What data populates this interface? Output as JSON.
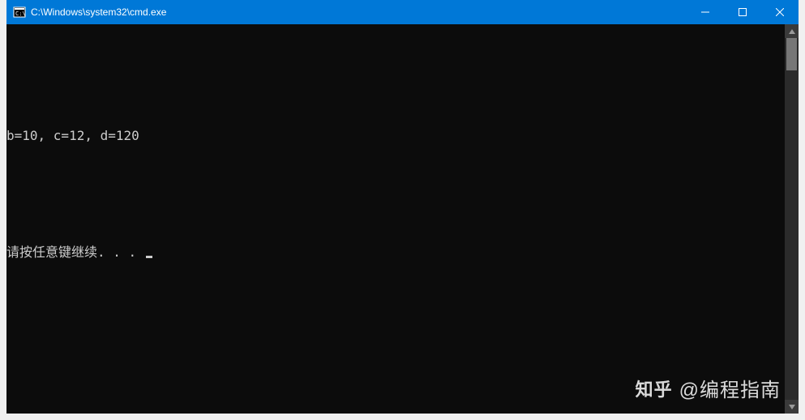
{
  "titlebar": {
    "title": "C:\\Windows\\system32\\cmd.exe"
  },
  "terminal": {
    "lines": [
      "",
      "b=10, c=12, d=120",
      "",
      "请按任意键继续. . . "
    ]
  },
  "watermark": {
    "logo": "知乎",
    "text": "@编程指南"
  }
}
